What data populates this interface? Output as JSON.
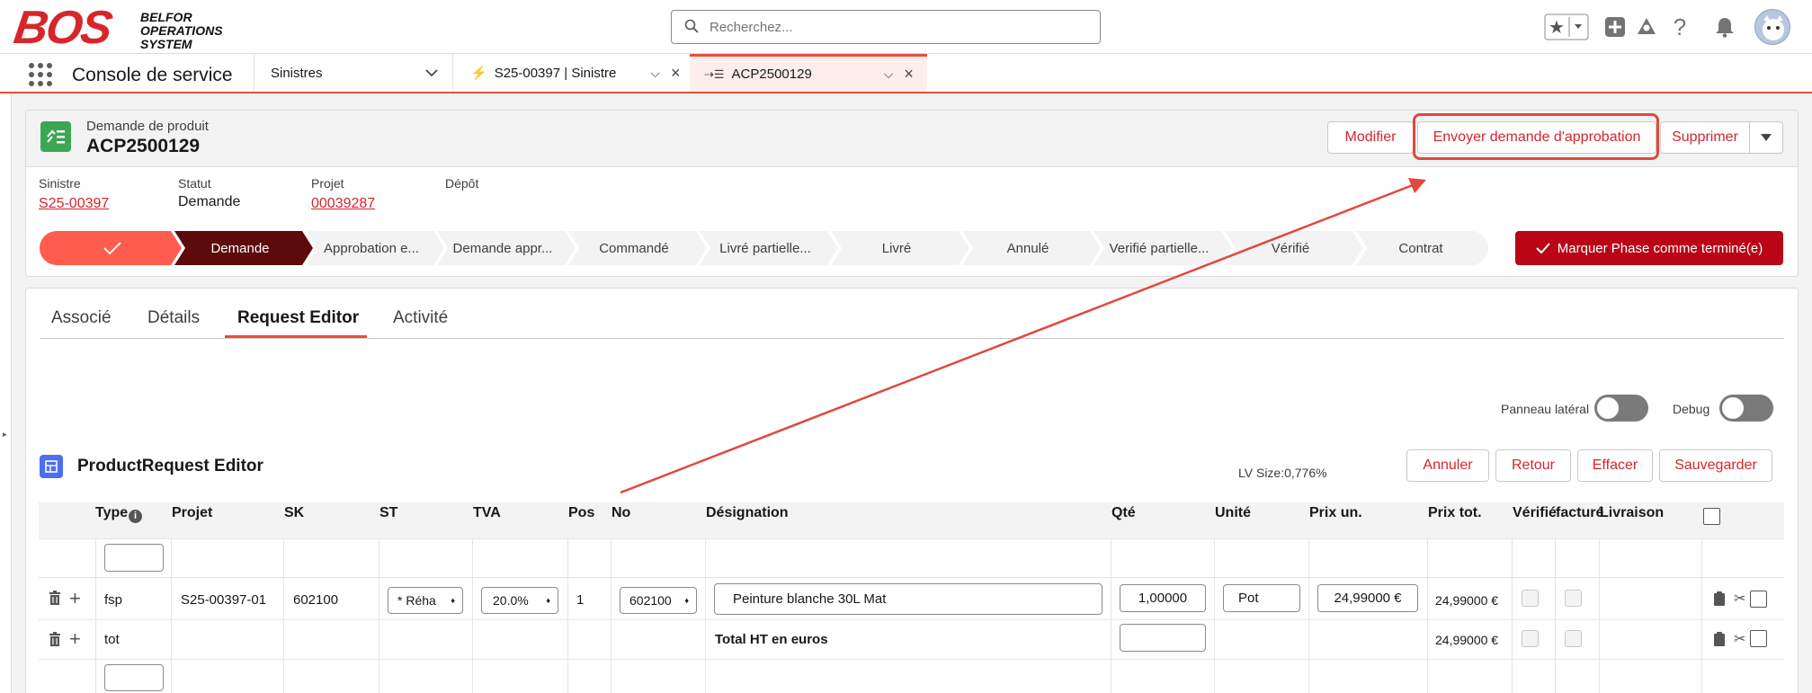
{
  "header": {
    "logo_text": "BOS",
    "logo_sub": [
      "BELFOR",
      "OPERATIONS",
      "SYSTEM"
    ],
    "search_placeholder": "Recherchez..."
  },
  "nav": {
    "app_name": "Console de service",
    "object_selector": "Sinistres",
    "tabs": [
      {
        "label": "S25-00397 | Sinistre",
        "active": false
      },
      {
        "label": "ACP2500129",
        "active": true
      }
    ]
  },
  "record": {
    "type": "Demande de produit",
    "name": "ACP2500129",
    "actions": {
      "edit": "Modifier",
      "send": "Envoyer demande d'approbation",
      "delete": "Supprimer"
    },
    "fields": [
      {
        "label": "Sinistre",
        "value": "S25-00397",
        "link": true
      },
      {
        "label": "Statut",
        "value": "Demande",
        "link": false
      },
      {
        "label": "Projet",
        "value": "00039287",
        "link": true
      },
      {
        "label": "Dépôt",
        "value": "",
        "link": false
      }
    ],
    "path": {
      "steps": [
        "",
        "Demande",
        "Approbation e...",
        "Demande appr...",
        "Commandé",
        "Livré partielle...",
        "Livré",
        "Annulé",
        "Verifié partielle...",
        "Vérifié",
        "Contrat"
      ],
      "complete_index": 0,
      "current_index": 1,
      "mark_button": "Marquer Phase comme terminé(e)"
    }
  },
  "content": {
    "tabs": [
      "Associé",
      "Détails",
      "Request Editor",
      "Activité"
    ],
    "active_tab": 2,
    "toggles": {
      "side_panel": "Panneau latéral",
      "debug": "Debug"
    },
    "editor_title": "ProductRequest Editor",
    "lv_size": "LV Size:0,776%",
    "buttons": {
      "cancel": "Annuler",
      "back": "Retour",
      "clear": "Effacer",
      "save": "Sauvegarder"
    },
    "columns": [
      "Type",
      "Projet",
      "SK",
      "ST",
      "TVA",
      "Pos",
      "No",
      "Désignation",
      "Qté",
      "Unité",
      "Prix un.",
      "Prix tot.",
      "Vérifié",
      "facturé",
      "Livraison"
    ],
    "rows": [
      {
        "type": "fsp",
        "projet": "S25-00397-01",
        "sk": "602100",
        "st": "* Réha",
        "tva": "20.0%",
        "pos": "1",
        "no": "602100",
        "designation": "Peinture blanche 30L Mat",
        "qte": "1,00000",
        "unite": "Pot",
        "prix_un": "24,99000 €",
        "prix_tot": "24,99000 €"
      },
      {
        "type": "tot",
        "designation": "Total HT en euros",
        "prix_tot": "24,99000 €"
      }
    ]
  },
  "colors": {
    "brand_red": "#d6262c",
    "success_green": "#3ba755",
    "path_current": "#5c0a0a",
    "path_complete": "#fe5c4c",
    "mark_button": "#ba0517"
  }
}
